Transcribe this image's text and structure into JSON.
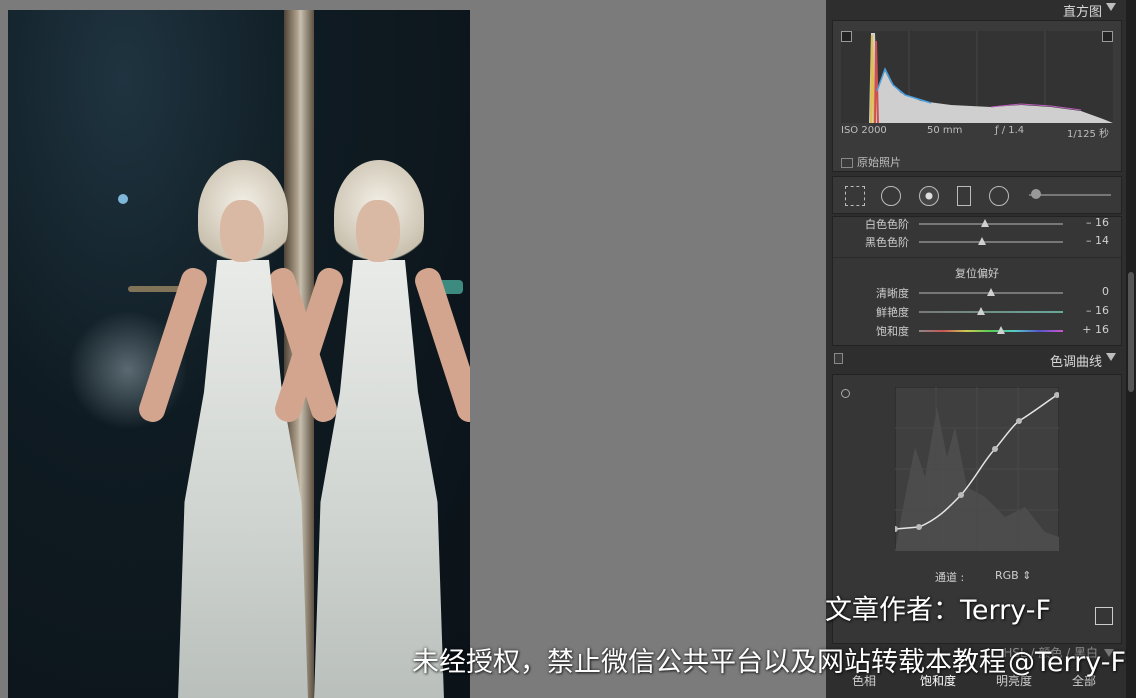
{
  "photo": {
    "description_name": "portrait photo"
  },
  "histogram": {
    "header": "直方图",
    "exif": {
      "iso": "ISO 2000",
      "focal": "50 mm",
      "aperture": "ƒ / 1.4",
      "shutter": "1/125 秒"
    },
    "original_label": "原始照片"
  },
  "basic": {
    "whites_label": "白色色阶",
    "whites_value": "– 16",
    "whites_pos": 0.46,
    "blacks_label": "黑色色阶",
    "blacks_value": "– 14",
    "blacks_pos": 0.44,
    "presence_title": "复位偏好",
    "clarity_label": "清晰度",
    "clarity_value": "0",
    "clarity_pos": 0.5,
    "vibrance_label": "鲜艳度",
    "vibrance_value": "– 16",
    "vibrance_pos": 0.43,
    "saturation_label": "饱和度",
    "saturation_value": "+ 16",
    "saturation_pos": 0.57
  },
  "tone_curve": {
    "header": "色调曲线",
    "channel_label": "通道 :",
    "channel_value": "RGB ⇕"
  },
  "hsl": {
    "header": "HSL / 颜色 / 黑白",
    "tabs": [
      "色相",
      "饱和度",
      "明亮度",
      "全部"
    ]
  },
  "watermark": {
    "line1": "文章作者：Terry-F",
    "line2": "未经授权，禁止微信公共平台以及网站转载本教程",
    "line2_tail": "@Terry-F"
  }
}
